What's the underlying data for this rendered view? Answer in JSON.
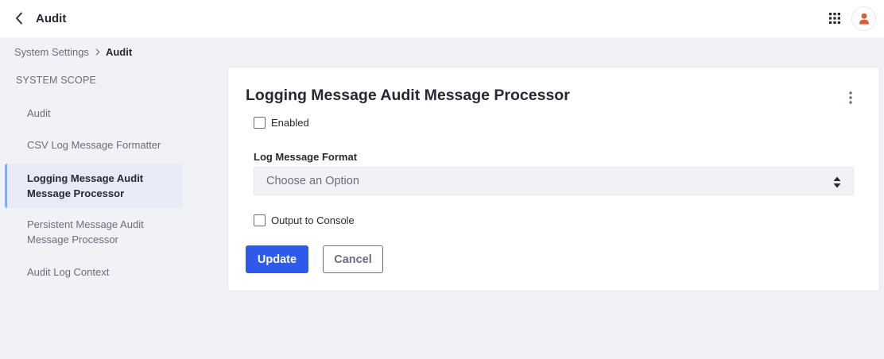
{
  "header": {
    "title": "Audit",
    "back_icon": "chevron-left-icon",
    "apps_icon": "apps-grid-icon",
    "avatar_icon": "user-icon",
    "avatar_color": "#e05a3a"
  },
  "breadcrumb": {
    "parent": "System Settings",
    "separator_icon": "chevron-right-icon",
    "current": "Audit"
  },
  "sidebar": {
    "scope_label": "SYSTEM SCOPE",
    "items": [
      {
        "label": "Audit",
        "active": false
      },
      {
        "label": "CSV Log Message Formatter",
        "active": false
      },
      {
        "label": "Logging Message Audit Message Processor",
        "active": true
      },
      {
        "label": "Persistent Message Audit Message Processor",
        "active": false
      },
      {
        "label": "Audit Log Context",
        "active": false
      }
    ]
  },
  "form": {
    "title": "Logging Message Audit Message Processor",
    "menu_icon": "kebab-menu-icon",
    "enabled_label": "Enabled",
    "enabled_checked": false,
    "log_format_label": "Log Message Format",
    "log_format_value": "Choose an Option",
    "select_icon": "caret-double-icon",
    "output_console_label": "Output to Console",
    "output_console_checked": false,
    "update_label": "Update",
    "cancel_label": "Cancel"
  },
  "colors": {
    "primary": "#2e5aec",
    "active_nav_bg": "#e6ebf5",
    "active_nav_border": "#80acff",
    "page_bg": "#f1f2f5"
  }
}
